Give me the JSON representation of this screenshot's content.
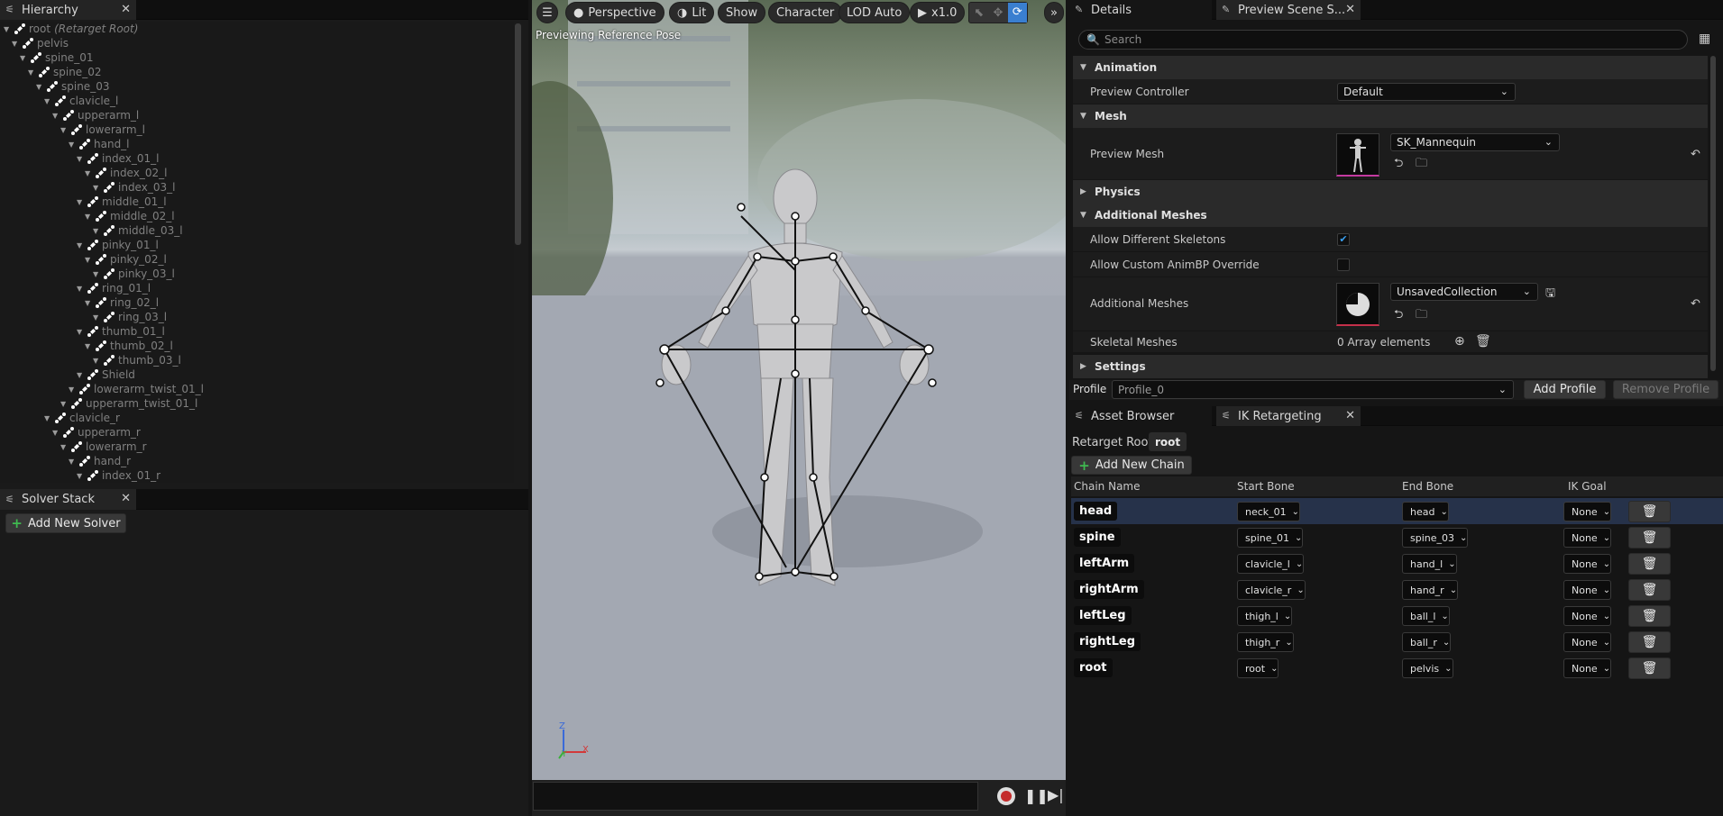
{
  "hierarchy": {
    "tab_title": "Hierarchy",
    "root_name": "root",
    "root_suffix": "(Retarget Root)",
    "bones": [
      {
        "name": "pelvis",
        "depth": 1
      },
      {
        "name": "spine_01",
        "depth": 2
      },
      {
        "name": "spine_02",
        "depth": 3
      },
      {
        "name": "spine_03",
        "depth": 4
      },
      {
        "name": "clavicle_l",
        "depth": 5
      },
      {
        "name": "upperarm_l",
        "depth": 6
      },
      {
        "name": "lowerarm_l",
        "depth": 7
      },
      {
        "name": "hand_l",
        "depth": 8
      },
      {
        "name": "index_01_l",
        "depth": 9
      },
      {
        "name": "index_02_l",
        "depth": 10
      },
      {
        "name": "index_03_l",
        "depth": 11
      },
      {
        "name": "middle_01_l",
        "depth": 9
      },
      {
        "name": "middle_02_l",
        "depth": 10
      },
      {
        "name": "middle_03_l",
        "depth": 11
      },
      {
        "name": "pinky_01_l",
        "depth": 9
      },
      {
        "name": "pinky_02_l",
        "depth": 10
      },
      {
        "name": "pinky_03_l",
        "depth": 11
      },
      {
        "name": "ring_01_l",
        "depth": 9
      },
      {
        "name": "ring_02_l",
        "depth": 10
      },
      {
        "name": "ring_03_l",
        "depth": 11
      },
      {
        "name": "thumb_01_l",
        "depth": 9
      },
      {
        "name": "thumb_02_l",
        "depth": 10
      },
      {
        "name": "thumb_03_l",
        "depth": 11
      },
      {
        "name": "Shield",
        "depth": 9
      },
      {
        "name": "lowerarm_twist_01_l",
        "depth": 8
      },
      {
        "name": "upperarm_twist_01_l",
        "depth": 7
      },
      {
        "name": "clavicle_r",
        "depth": 5
      },
      {
        "name": "upperarm_r",
        "depth": 6
      },
      {
        "name": "lowerarm_r",
        "depth": 7
      },
      {
        "name": "hand_r",
        "depth": 8
      },
      {
        "name": "index_01_r",
        "depth": 9
      }
    ]
  },
  "solver": {
    "tab_title": "Solver Stack",
    "add_label": "Add New Solver"
  },
  "viewport": {
    "perspective": "Perspective",
    "lit": "Lit",
    "show": "Show",
    "character": "Character",
    "lod": "LOD Auto",
    "speed": "x1.0",
    "overlay_text": "Previewing Reference Pose",
    "axis_z": "Z",
    "axis_x": "X",
    "axis_y": "Y"
  },
  "details": {
    "tab_details": "Details",
    "tab_preview": "Preview Scene S...",
    "search_placeholder": "Search",
    "sections": {
      "animation": "Animation",
      "mesh": "Mesh",
      "physics": "Physics",
      "additional_meshes": "Additional Meshes",
      "settings": "Settings"
    },
    "preview_controller_label": "Preview Controller",
    "preview_controller_value": "Default",
    "preview_mesh_label": "Preview Mesh",
    "preview_mesh_value": "SK_Mannequin",
    "allow_diff_skeletons_label": "Allow Different Skeletons",
    "allow_diff_skeletons_checked": true,
    "allow_custom_animbp_label": "Allow Custom AnimBP Override",
    "allow_custom_animbp_checked": false,
    "additional_meshes_label": "Additional Meshes",
    "additional_meshes_value": "UnsavedCollection",
    "skeletal_meshes_label": "Skeletal Meshes",
    "skeletal_meshes_value": "0 Array elements",
    "profile_label": "Profile",
    "profile_value": "Profile_0",
    "add_profile": "Add Profile",
    "remove_profile": "Remove Profile"
  },
  "ik": {
    "tab_asset_browser": "Asset Browser",
    "tab_ik": "IK Retargeting",
    "retarget_root_label": "Retarget Root:",
    "retarget_root_value": "root",
    "add_chain": "Add New Chain",
    "columns": [
      "Chain Name",
      "Start Bone",
      "End Bone",
      "IK Goal"
    ],
    "rows": [
      {
        "name": "head",
        "start": "neck_01",
        "end": "head",
        "goal": "None",
        "selected": true
      },
      {
        "name": "spine",
        "start": "spine_01",
        "end": "spine_03",
        "goal": "None",
        "selected": false
      },
      {
        "name": "leftArm",
        "start": "clavicle_l",
        "end": "hand_l",
        "goal": "None",
        "selected": false
      },
      {
        "name": "rightArm",
        "start": "clavicle_r",
        "end": "hand_r",
        "goal": "None",
        "selected": false
      },
      {
        "name": "leftLeg",
        "start": "thigh_l",
        "end": "ball_l",
        "goal": "None",
        "selected": false
      },
      {
        "name": "rightLeg",
        "start": "thigh_r",
        "end": "ball_r",
        "goal": "None",
        "selected": false
      },
      {
        "name": "root",
        "start": "root",
        "end": "pelvis",
        "goal": "None",
        "selected": false
      }
    ]
  },
  "colors": {
    "accent_blue": "#3aa0f0",
    "add_green": "#3fb950",
    "selected_row": "#26324a"
  }
}
